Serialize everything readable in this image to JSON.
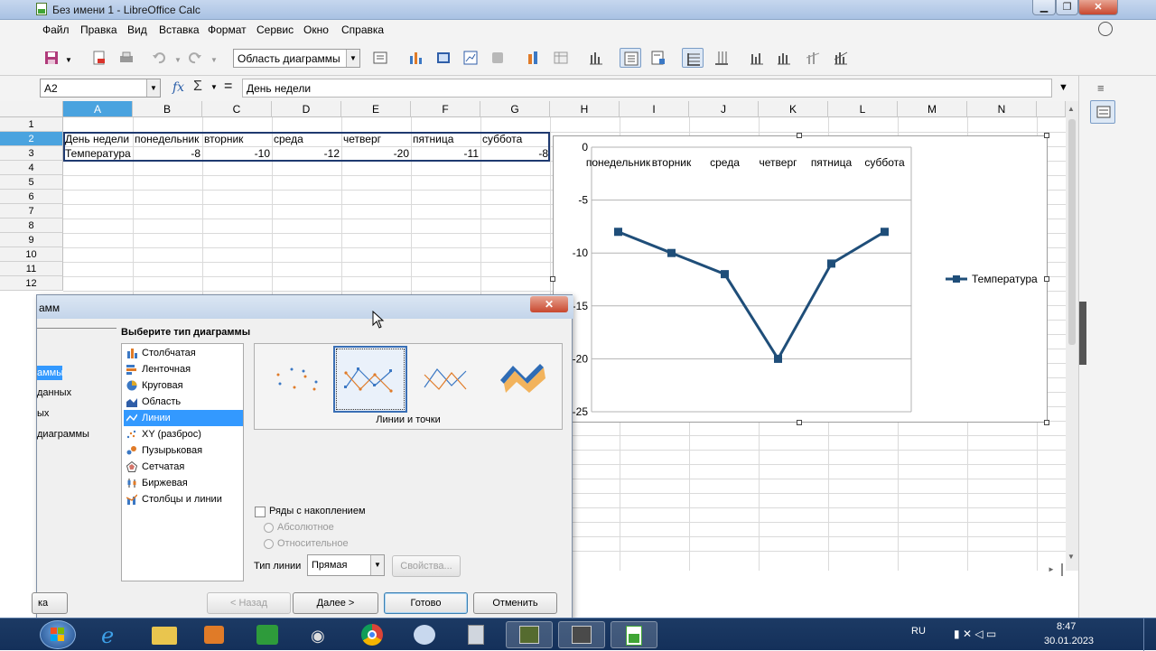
{
  "window": {
    "title": "Без имени 1 - LibreOffice Calc",
    "min": "▁",
    "max": "❐",
    "close": "✕"
  },
  "menu": [
    "Файл",
    "Правка",
    "Вид",
    "Вставка",
    "Формат",
    "Сервис",
    "Окно",
    "Справка"
  ],
  "toolbar": {
    "object_combo": "Область диаграммы"
  },
  "formula": {
    "cell_ref": "A2",
    "fx": "fx",
    "sigma": "Σ",
    "equals": "=",
    "content": "День недели"
  },
  "columns": [
    "A",
    "B",
    "C",
    "D",
    "E",
    "F",
    "G",
    "H",
    "I",
    "J",
    "K",
    "L",
    "M",
    "N"
  ],
  "rows": [
    "1",
    "2",
    "3",
    "4",
    "5",
    "6",
    "7",
    "8",
    "9",
    "10",
    "11",
    "12"
  ],
  "cells": {
    "r2": [
      "День недели",
      "понедельник",
      "вторник",
      "среда",
      "четверг",
      "пятница",
      "суббота"
    ],
    "r3_label": "Температура",
    "r3_values": [
      "-8",
      "-10",
      "-12",
      "-20",
      "-11",
      "-8"
    ]
  },
  "chart_data": {
    "type": "line",
    "categories": [
      "понедельник",
      "вторник",
      "среда",
      "четверг",
      "пятница",
      "суббота"
    ],
    "series": [
      {
        "name": "Температура",
        "values": [
          -8,
          -10,
          -12,
          -20,
          -11,
          -8
        ]
      }
    ],
    "ylim": [
      -25,
      0
    ],
    "yticks": [
      "0",
      "-5",
      "-10",
      "-15",
      "-20",
      "-25"
    ],
    "legend": "right",
    "grid": true,
    "color": "#1f4e79"
  },
  "dialog": {
    "title_fragment": "амм",
    "steps": [
      "аммы",
      "данных",
      "ых",
      "диаграммы"
    ],
    "heading": "Выберите тип диаграммы",
    "types": [
      "Столбчатая",
      "Ленточная",
      "Круговая",
      "Область",
      "Линии",
      "XY (разброс)",
      "Пузырьковая",
      "Сетчатая",
      "Биржевая",
      "Столбцы и линии"
    ],
    "selected_type": "Линии",
    "variant_label": "Линии и точки",
    "stacked_label": "Ряды с накоплением",
    "absolute_label": "Абсолютное",
    "relative_label": "Относительное",
    "line_type_label": "Тип линии",
    "line_type_value": "Прямая",
    "properties_btn": "Свойства...",
    "help_fragment": "ка",
    "back_btn": "< Назад",
    "next_btn": "Далее >",
    "finish_btn": "Готово",
    "cancel_btn": "Отменить"
  },
  "taskbar": {
    "lang": "RU",
    "time": "8:47",
    "date": "30.01.2023"
  }
}
